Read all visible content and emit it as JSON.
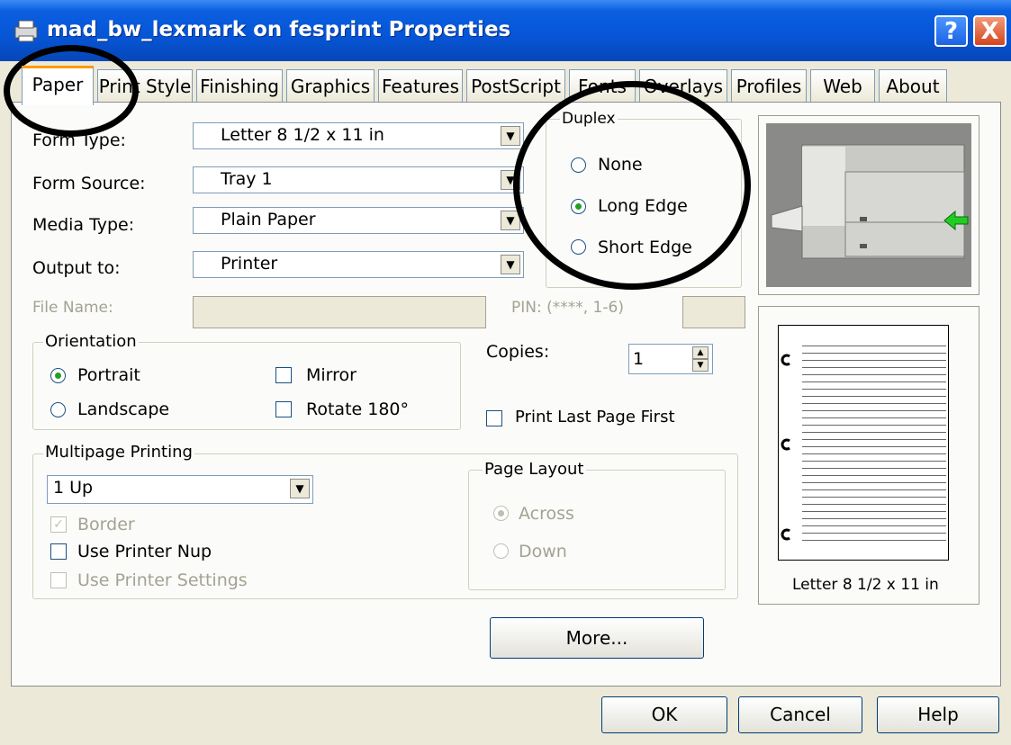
{
  "window": {
    "title": "mad_bw_lexmark on fesprint Properties"
  },
  "title_buttons": {
    "help": "?",
    "close": "X"
  },
  "tabs": [
    {
      "label": "Paper"
    },
    {
      "label": "Print Style"
    },
    {
      "label": "Finishing"
    },
    {
      "label": "Graphics"
    },
    {
      "label": "Features"
    },
    {
      "label": "PostScript"
    },
    {
      "label": "Fonts"
    },
    {
      "label": "Overlays"
    },
    {
      "label": "Profiles"
    },
    {
      "label": "Web"
    },
    {
      "label": "About"
    }
  ],
  "paper": {
    "form_type": {
      "label": "Form Type:",
      "value": "Letter 8 1/2 x 11 in"
    },
    "form_source": {
      "label": "Form Source:",
      "value": "Tray 1"
    },
    "media_type": {
      "label": "Media Type:",
      "value": "Plain Paper"
    },
    "output_to": {
      "label": "Output to:",
      "value": "Printer"
    },
    "file_name": {
      "label": "File Name:",
      "value": ""
    },
    "pin": {
      "label": "PIN: (****, 1-6)",
      "value": ""
    },
    "duplex": {
      "legend": "Duplex",
      "options": [
        "None",
        "Long Edge",
        "Short Edge"
      ],
      "selected": "Long Edge"
    },
    "orientation": {
      "legend": "Orientation",
      "portrait": "Portrait",
      "landscape": "Landscape",
      "mirror": "Mirror",
      "rotate": "Rotate 180°",
      "selected": "Portrait"
    },
    "copies": {
      "label": "Copies:",
      "value": "1"
    },
    "print_last_page_first": {
      "label": "Print Last Page First",
      "checked": false
    },
    "multipage": {
      "legend": "Multipage Printing",
      "value": "1 Up",
      "border": "Border",
      "use_printer_nup": "Use Printer Nup",
      "use_printer_settings": "Use Printer Settings"
    },
    "page_layout": {
      "legend": "Page Layout",
      "across": "Across",
      "down": "Down",
      "selected": "Across"
    },
    "preview_caption": "Letter 8 1/2 x 11 in",
    "more_button": "More..."
  },
  "footer": {
    "ok": "OK",
    "cancel": "Cancel",
    "help": "Help"
  },
  "icons": {
    "dropdown": "▼",
    "spin_up": "▲",
    "spin_down": "▼",
    "check": "✓"
  },
  "colors": {
    "title_bar": "#0655d6",
    "dialog_bg": "#ece9d8",
    "arrow": "#22cc22"
  }
}
